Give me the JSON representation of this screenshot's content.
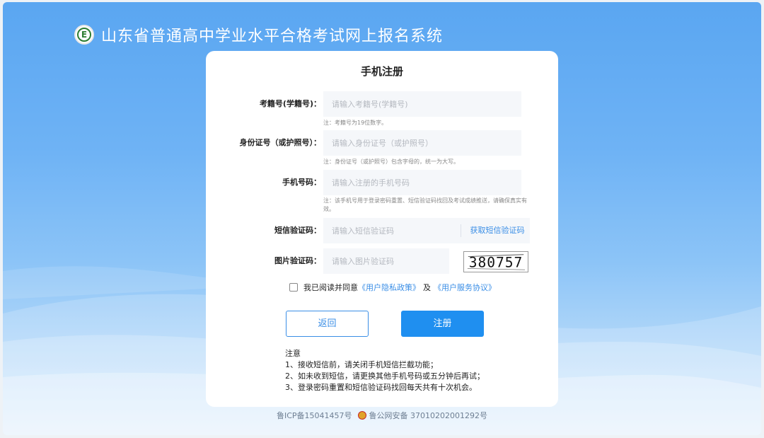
{
  "header": {
    "title": "山东省普通高中学业水平合格考试网上报名系统",
    "logo_letter": "E"
  },
  "form": {
    "title": "手机注册",
    "fields": [
      {
        "label": "考籍号(学籍号)：",
        "placeholder": "请输入考籍号(学籍号)",
        "note": "注：考籍号为19位数字。"
      },
      {
        "label": "身份证号（或护照号）：",
        "placeholder": "请输入身份证号（或护照号）",
        "note": "注：身份证号（或护照号）包含字母的，统一为大写。"
      },
      {
        "label": "手机号码：",
        "placeholder": "请输入注册的手机号码",
        "note": "注：该手机号用于登录密码重置、短信验证码找回及考试成绩推送，请确保真实有效。"
      },
      {
        "label": "短信验证码：",
        "placeholder": "请输入短信验证码",
        "button": "获取短信验证码"
      },
      {
        "label": "图片验证码：",
        "placeholder": "请输入图片验证码",
        "captcha": "380757"
      }
    ],
    "agree": {
      "prefix": "我已阅读并同意",
      "privacy": "《用户隐私政策》",
      "and": "及",
      "service": "《用户服务协议》"
    },
    "back_label": "返回",
    "register_label": "注册"
  },
  "notes": {
    "title": "注意",
    "items": [
      "1、接收短信前，请关闭手机短信拦截功能；",
      "2、如未收到短信，请更换其他手机号码或五分钟后再试；",
      "3、登录密码重置和短信验证码找回每天共有十次机会。"
    ]
  },
  "footer": {
    "icp": "鲁ICP备15041457号",
    "police": "鲁公网安备 37010202001292号"
  }
}
